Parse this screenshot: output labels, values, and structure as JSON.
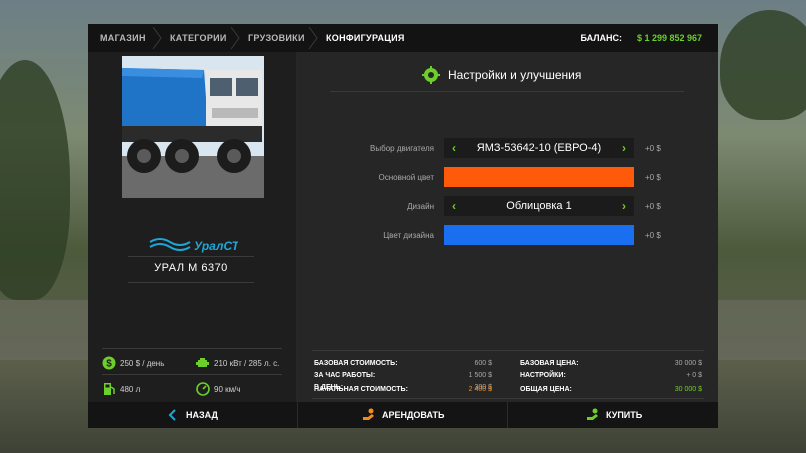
{
  "breadcrumb": [
    "МАГАЗИН",
    "КАТЕГОРИИ",
    "ГРУЗОВИКИ",
    "КОНФИГУРАЦИЯ"
  ],
  "balance": {
    "label": "БАЛАНС:",
    "value": "$ 1 299 852 967"
  },
  "vehicle": {
    "brand": "УралСТ",
    "name": "УРАЛ М 6370",
    "specs": {
      "daily": "250 $ / день",
      "power": "210 кВт / 285 л. с.",
      "fuel": "480 л",
      "speed": "90 км/ч"
    }
  },
  "config": {
    "title": "Настройки и улучшения",
    "rows": [
      {
        "label": "Выбор двигателя",
        "type": "selector",
        "value": "ЯМЗ-53642-10 (ЕВРО-4)",
        "price": "+0 $"
      },
      {
        "label": "Основной цвет",
        "type": "color",
        "color": "#ff5a0a",
        "price": "+0 $"
      },
      {
        "label": "Дизайн",
        "type": "selector",
        "value": "Облицовка 1",
        "price": "+0 $"
      },
      {
        "label": "Цвет дизайна",
        "type": "color",
        "color": "#1a6ff0",
        "price": "+0 $"
      }
    ]
  },
  "costs": {
    "base_cost_label": "БАЗОВАЯ СТОИМОСТЬ:",
    "base_cost": "600 $",
    "per_hour_label": "ЗА ЧАС РАБОТЫ:",
    "per_hour": "1 500 $",
    "per_day_label": "В ДЕНЬ:",
    "per_day": "300 $",
    "initial_cost_label": "НАЧАЛЬНАЯ СТОИМОСТЬ:",
    "initial_cost": "2 400 $",
    "base_price_label": "БАЗОВАЯ ЦЕНА:",
    "base_price": "30 000 $",
    "settings_label": "НАСТРОЙКИ:",
    "settings": "+ 0 $",
    "total_label": "ОБЩАЯ ЦЕНА:",
    "total": "30 000 $"
  },
  "actions": {
    "back": "НАЗАД",
    "rent": "АРЕНДОВАТЬ",
    "buy": "КУПИТЬ"
  },
  "colors": {
    "accent_green": "#6ccf2a",
    "orange_value": "#f28c1e"
  }
}
